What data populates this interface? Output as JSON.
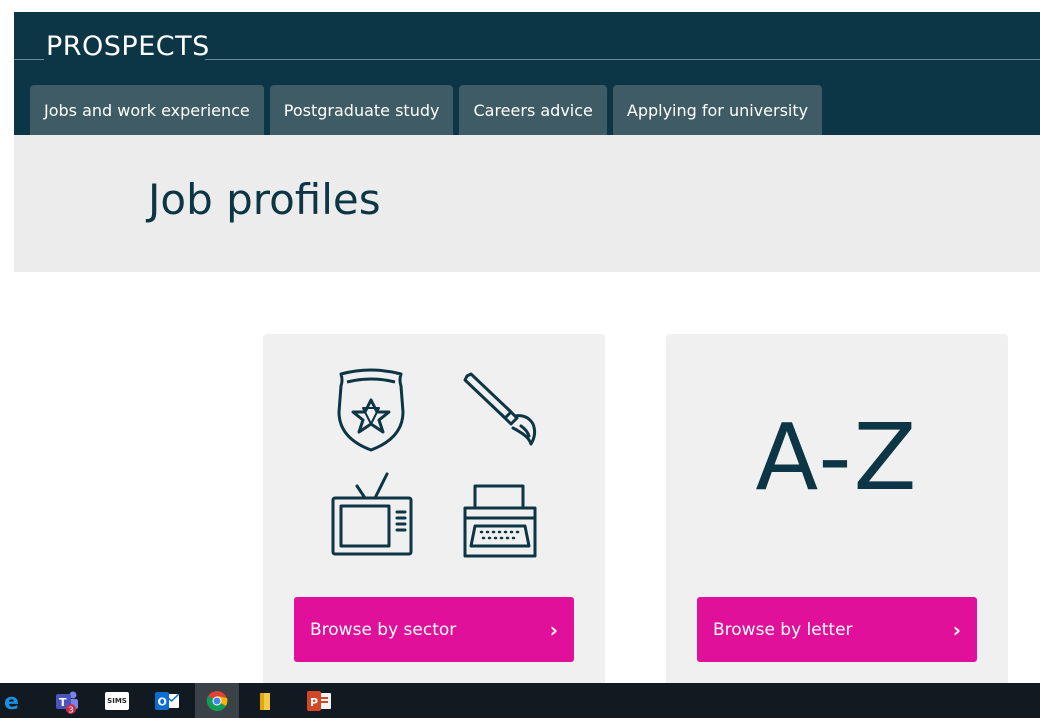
{
  "header": {
    "logo": "PROSPECTS",
    "nav": [
      {
        "label": "Jobs and work experience"
      },
      {
        "label": "Postgraduate study"
      },
      {
        "label": "Careers advice"
      },
      {
        "label": "Applying for university"
      }
    ]
  },
  "page": {
    "title": "Job profiles"
  },
  "cards": {
    "sector": {
      "icons": [
        "police-badge-icon",
        "paintbrush-icon",
        "television-icon",
        "typewriter-icon"
      ],
      "button_label": "Browse by sector",
      "chevron": "›"
    },
    "letter": {
      "display": "A-Z",
      "button_label": "Browse by letter",
      "chevron": "›"
    }
  },
  "taskbar": {
    "icons": [
      "edge-icon",
      "teams-icon",
      "sims-icon",
      "outlook-icon",
      "chrome-icon",
      "file-explorer-icon",
      "powerpoint-icon"
    ],
    "teams_badge": "3",
    "sims_label": "SIMS"
  },
  "colors": {
    "header_bg": "#0c3545",
    "tab_bg": "#3f5b66",
    "accent": "#e1109b",
    "band_bg": "#ececec",
    "card_bg": "#f0f0f0"
  }
}
